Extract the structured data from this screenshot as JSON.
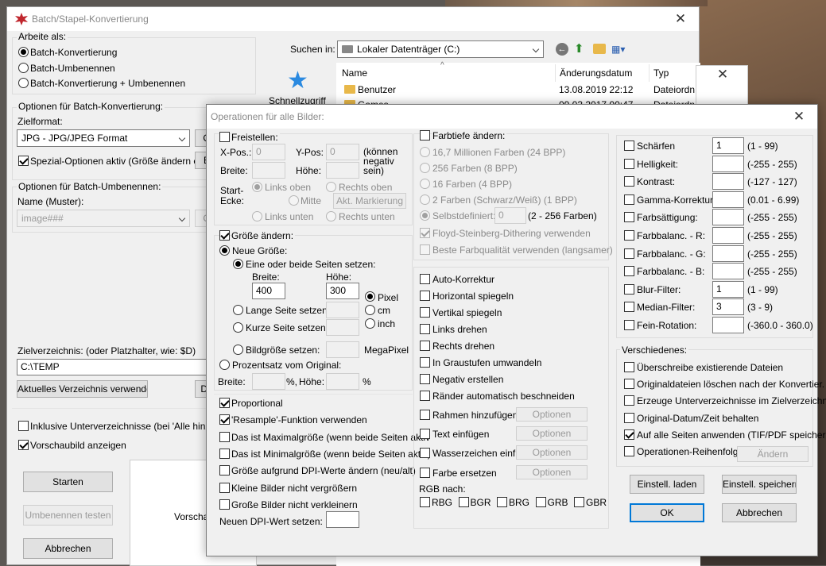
{
  "main": {
    "title": "Batch/Stapel-Konvertierung",
    "work_as": {
      "label": "Arbeite als:",
      "options": [
        "Batch-Konvertierung",
        "Batch-Umbenennen",
        "Batch-Konvertierung + Umbenennen"
      ]
    },
    "conv_options_label": "Optionen für Batch-Konvertierung:",
    "target_format_label": "Zielformat:",
    "target_format_value": "JPG - JPG/JPEG Format",
    "options_btn": "O",
    "special_options": "Spezial-Optionen aktiv (Größe ändern etc.)",
    "special_btn": "E",
    "rename_options_label": "Optionen für Batch-Umbenennen:",
    "name_pattern_label": "Name (Muster):",
    "name_pattern_value": "image###",
    "name_btn": "O",
    "target_dir_label": "Zielverzeichnis: (oder Platzhalter, wie: $D)",
    "target_dir_value": "C:\\TEMP",
    "use_current_dir": "Aktuelles Verzeichnis verwenden",
    "browse_btn": "Du",
    "include_subdirs": "Inklusive Unterverzeichnisse (bei 'Alle hinzuf.'; n",
    "show_preview": "Vorschaubild anzeigen",
    "start": "Starten",
    "test_rename": "Umbenennen testen",
    "cancel": "Abbrechen",
    "preview_label": "Vorscha"
  },
  "file_browser": {
    "search_in_label": "Suchen in:",
    "location": "Lokaler Datenträger (C:)",
    "quick_access": "Schnellzugriff",
    "columns": [
      "Name",
      "Änderungsdatum",
      "Typ"
    ],
    "rows": [
      {
        "name": "Benutzer",
        "date": "13.08.2019 22:12",
        "type": "Dateiordn"
      },
      {
        "name": "Games",
        "date": "09.03.2017 00:47",
        "type": "Dateiordn"
      }
    ]
  },
  "dialog": {
    "title": "Operationen für alle Bilder:",
    "crop": {
      "label": "Freistellen:",
      "xpos": "X-Pos.:",
      "xpos_value": "0",
      "ypos": "Y-Pos:",
      "ypos_value": "0",
      "neg_note": "(können negativ sein)",
      "width": "Breite:",
      "height": "Höhe:",
      "corner": "Start-Ecke:",
      "top_left": "Links oben",
      "top_right": "Rechts oben",
      "center": "Mitte",
      "mark_btn": "Akt. Markierung",
      "bottom_left": "Links unten",
      "bottom_right": "Rechts unten"
    },
    "resize": {
      "label": "Größe ändern:",
      "new_size": "Neue Größe:",
      "one_or_both": "Eine oder beide Seiten setzen:",
      "width_label": "Breite:",
      "height_label": "Höhe:",
      "width_value": "400",
      "height_value": "300",
      "units": [
        "Pixel",
        "cm",
        "inch"
      ],
      "long_side": "Lange Seite setzen:",
      "short_side": "Kurze Seite setzen:",
      "image_size": "Bildgröße setzen:",
      "megapixel": "MegaPixel",
      "percent": "Prozentsatz vom Original:",
      "pct_width": "Breite:",
      "pct_height": "Höhe:",
      "pct": "%",
      "pct_comma": "%,"
    },
    "resize_opts": [
      {
        "label": "Proportional",
        "checked": true
      },
      {
        "label": "'Resample'-Funktion verwenden",
        "checked": true
      },
      {
        "label": "Das ist Maximalgröße (wenn beide Seiten aktiv",
        "checked": false
      },
      {
        "label": "Das ist Minimalgröße (wenn beide Seiten aktiv)",
        "checked": false
      },
      {
        "label": "Größe aufgrund DPI-Werte ändern (neu/alt)",
        "checked": false
      },
      {
        "label": "Kleine Bilder nicht vergrößern",
        "checked": false
      },
      {
        "label": "Große Bilder nicht verkleinern",
        "checked": false
      }
    ],
    "dpi_label": "Neuen DPI-Wert setzen:",
    "color_depth": {
      "label": "Farbtiefe ändern:",
      "options": [
        "16,7 Millionen Farben (24 BPP)",
        "256 Farben (8 BPP)",
        "16 Farben (4 BPP)",
        "2 Farben (Schwarz/Weiß) (1 BPP)"
      ],
      "custom": "Selbstdefiniert:",
      "custom_value": "0",
      "custom_range": "(2 - 256 Farben)",
      "dither": "Floyd-Steinberg-Dithering verwenden",
      "best_quality": "Beste Farbqualität verwenden (langsamer)"
    },
    "ops": [
      "Auto-Korrektur",
      "Horizontal spiegeln",
      "Vertikal spiegeln",
      "Links drehen",
      "Rechts drehen",
      "In Graustufen umwandeln",
      "Negativ erstellen",
      "Ränder automatisch beschneiden"
    ],
    "ops_with_btn": [
      "Rahmen hinzufügen",
      "Text einfügen",
      "Wasserzeichen einf.",
      "Farbe ersetzen"
    ],
    "options_btn": "Optionen",
    "rgb_label": "RGB nach:",
    "rgb": [
      "RBG",
      "BGR",
      "BRG",
      "GRB",
      "GBR"
    ],
    "adjust": [
      {
        "label": "Schärfen",
        "value": "1",
        "range": "(1  -  99)"
      },
      {
        "label": "Helligkeit:",
        "value": "",
        "range": "(-255  -  255)"
      },
      {
        "label": "Kontrast:",
        "value": "",
        "range": "(-127  -  127)"
      },
      {
        "label": "Gamma-Korrektur:",
        "value": "",
        "range": "(0.01  -  6.99)"
      },
      {
        "label": "Farbsättigung:",
        "value": "",
        "range": "(-255  -  255)"
      },
      {
        "label": "Farbbalanc. - R:",
        "value": "",
        "range": "(-255  -  255)"
      },
      {
        "label": "Farbbalanc. - G:",
        "value": "",
        "range": "(-255  -  255)"
      },
      {
        "label": "Farbbalanc. - B:",
        "value": "",
        "range": "(-255  -  255)"
      },
      {
        "label": "Blur-Filter:",
        "value": "1",
        "range": "(1  -  99)"
      },
      {
        "label": "Median-Filter:",
        "value": "3",
        "range": "(3  -  9)"
      },
      {
        "label": "Fein-Rotation:",
        "value": "",
        "range": "(-360.0  -  360.0)"
      }
    ],
    "misc": {
      "label": "Verschiedenes:",
      "items": [
        {
          "label": "Überschreibe existierende Dateien",
          "checked": false
        },
        {
          "label": "Originaldateien löschen nach der Konvertier.",
          "checked": false
        },
        {
          "label": "Erzeuge Unterverzeichnisse im Zielverzeichn.",
          "checked": false
        },
        {
          "label": "Original-Datum/Zeit behalten",
          "checked": false
        },
        {
          "label": "Auf alle Seiten anwenden (TIF/PDF speichern)",
          "checked": true
        },
        {
          "label": "Operationen-Reihenfolge",
          "checked": false
        }
      ],
      "change_btn": "Ändern"
    },
    "load_btn": "Einstell. laden",
    "save_btn": "Einstell. speichern",
    "ok": "OK",
    "cancel": "Abbrechen"
  }
}
